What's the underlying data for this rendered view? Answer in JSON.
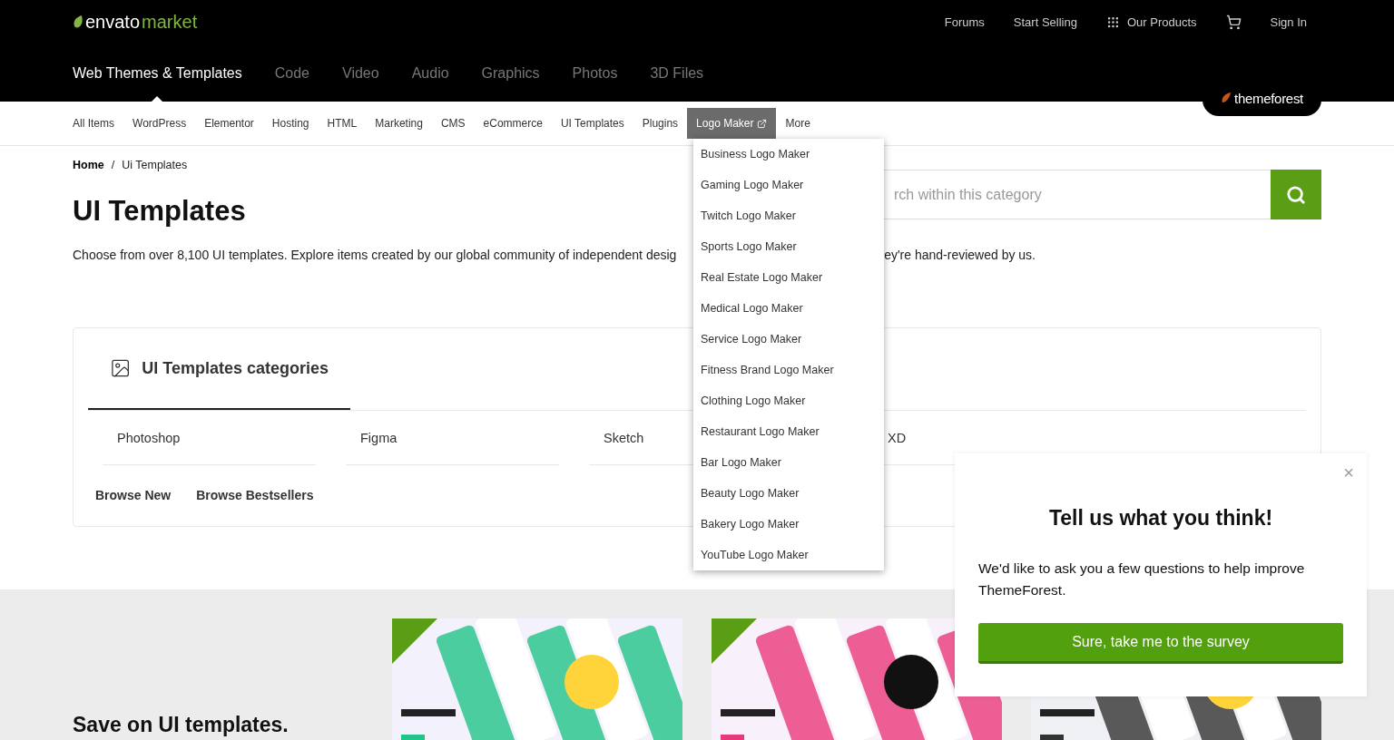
{
  "header": {
    "logo": {
      "brand": "envato",
      "product": "market"
    },
    "top_links": [
      "Forums",
      "Start Selling",
      "Our Products"
    ],
    "sign_in": "Sign In"
  },
  "market_nav": [
    {
      "label": "Web Themes & Templates",
      "selected": true
    },
    {
      "label": "Code",
      "selected": false
    },
    {
      "label": "Video",
      "selected": false
    },
    {
      "label": "Audio",
      "selected": false
    },
    {
      "label": "Graphics",
      "selected": false
    },
    {
      "label": "Photos",
      "selected": false
    },
    {
      "label": "3D Files",
      "selected": false
    }
  ],
  "site_badge": "themeforest",
  "subnav": [
    {
      "label": "All Items",
      "selected": false,
      "external": false
    },
    {
      "label": "WordPress",
      "selected": false,
      "external": false
    },
    {
      "label": "Elementor",
      "selected": false,
      "external": false
    },
    {
      "label": "Hosting",
      "selected": false,
      "external": false
    },
    {
      "label": "HTML",
      "selected": false,
      "external": false
    },
    {
      "label": "Marketing",
      "selected": false,
      "external": false
    },
    {
      "label": "CMS",
      "selected": false,
      "external": false
    },
    {
      "label": "eCommerce",
      "selected": false,
      "external": false
    },
    {
      "label": "UI Templates",
      "selected": false,
      "external": false
    },
    {
      "label": "Plugins",
      "selected": false,
      "external": false
    },
    {
      "label": "Logo Maker",
      "selected": true,
      "external": true
    },
    {
      "label": "More",
      "selected": false,
      "external": false
    }
  ],
  "dropdown": [
    "Business Logo Maker",
    "Gaming Logo Maker",
    "Twitch Logo Maker",
    "Sports Logo Maker",
    "Real Estate Logo Maker",
    "Medical Logo Maker",
    "Service Logo Maker",
    "Fitness Brand Logo Maker",
    "Clothing Logo Maker",
    "Restaurant Logo Maker",
    "Bar Logo Maker",
    "Beauty Logo Maker",
    "Bakery Logo Maker",
    "YouTube Logo Maker"
  ],
  "breadcrumb": {
    "items": [
      "Home",
      "Ui Templates"
    ],
    "separator": "/"
  },
  "title": "UI Templates",
  "description": {
    "before": "Choose from over 8,100 UI templates. Explore items created by our global community of independent desig",
    "after": "ey're hand-reviewed by us."
  },
  "search": {
    "placeholder": "rch within this category"
  },
  "categories_card": {
    "tabs": [
      {
        "label": "UI Templates categories",
        "selected": true
      }
    ],
    "items": [
      "Photoshop",
      "Figma",
      "Sketch",
      "XD"
    ],
    "links": [
      "Browse New",
      "Browse Bestsellers"
    ]
  },
  "promo": {
    "heading": "Save on UI templates."
  },
  "survey": {
    "close": "×",
    "title": "Tell us what you think!",
    "text": "We'd like to ask you a few questions to help improve ThemeForest.",
    "button": "Sure, take me to the survey"
  }
}
